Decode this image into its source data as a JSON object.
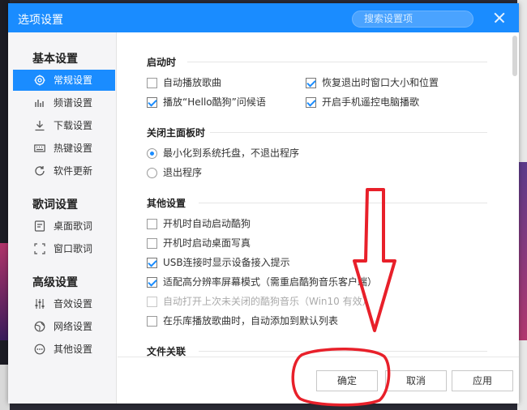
{
  "window": {
    "title": "选项设置",
    "search_placeholder": "搜索设置项"
  },
  "sidebar": {
    "groups": [
      {
        "title": "基本设置",
        "items": [
          {
            "label": "常规设置",
            "icon": "gear-icon",
            "active": true
          },
          {
            "label": "频谱设置",
            "icon": "spectrum-icon"
          },
          {
            "label": "下载设置",
            "icon": "download-icon"
          },
          {
            "label": "热键设置",
            "icon": "keyboard-icon"
          },
          {
            "label": "软件更新",
            "icon": "update-icon"
          }
        ]
      },
      {
        "title": "歌词设置",
        "items": [
          {
            "label": "桌面歌词",
            "icon": "desktop-lyrics-icon"
          },
          {
            "label": "窗口歌词",
            "icon": "window-lyrics-icon"
          }
        ]
      },
      {
        "title": "高级设置",
        "items": [
          {
            "label": "音效设置",
            "icon": "equalizer-icon"
          },
          {
            "label": "网络设置",
            "icon": "network-icon"
          },
          {
            "label": "其他设置",
            "icon": "more-icon"
          }
        ]
      }
    ]
  },
  "content": {
    "startup": {
      "title": "启动时",
      "options": [
        {
          "label": "自动播放歌曲",
          "checked": false
        },
        {
          "label": "恢复退出时窗口大小和位置",
          "checked": true
        },
        {
          "label": "播放“Hello酷狗”问候语",
          "checked": true
        },
        {
          "label": "开启手机遥控电脑播歌",
          "checked": true
        }
      ]
    },
    "close_panel": {
      "title": "关闭主面板时",
      "options": [
        {
          "label": "最小化到系统托盘，不退出程序",
          "selected": true
        },
        {
          "label": "退出程序",
          "selected": false
        }
      ]
    },
    "other": {
      "title": "其他设置",
      "options": [
        {
          "label": "开机时自动启动酷狗",
          "checked": false,
          "disabled": false
        },
        {
          "label": "开机时启动桌面写真",
          "checked": false,
          "disabled": false
        },
        {
          "label": "USB连接时显示设备接入提示",
          "checked": true,
          "disabled": false
        },
        {
          "label": "适配高分辨率屏幕模式（需重启酷狗音乐客户端）",
          "checked": true,
          "disabled": false
        },
        {
          "label": "自动打开上次未关闭的酷狗音乐（Win10 有效）",
          "checked": false,
          "disabled": true
        },
        {
          "label": "在乐库播放歌曲时，自动添加到默认列表",
          "checked": false,
          "disabled": false
        }
      ]
    },
    "file_assoc": {
      "title": "文件关联"
    }
  },
  "footer": {
    "ok_label": "确定",
    "cancel_label": "取消",
    "apply_label": "应用"
  },
  "colors": {
    "accent": "#1a8cff",
    "annotation": "#e8202a"
  }
}
